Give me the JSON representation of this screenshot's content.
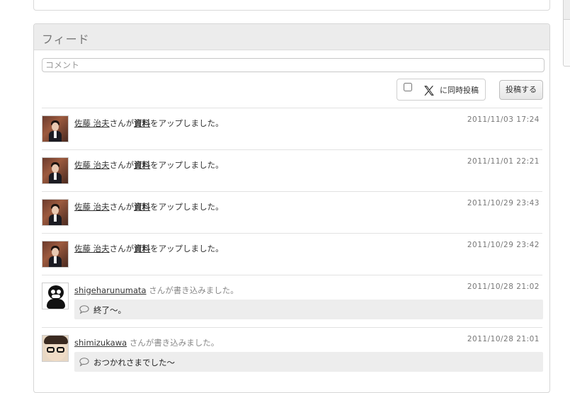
{
  "feed": {
    "title": "フィード",
    "comment_placeholder": "コメント",
    "x_share_label": "に同時投稿",
    "x_share_checked": false,
    "post_button": "投稿する"
  },
  "items": [
    {
      "user": "佐藤 治夫",
      "text_before": "さんが",
      "link": "資料",
      "text_after": "をアップしました。",
      "timestamp": "2011/11/03 17:24"
    },
    {
      "user": "佐藤 治夫",
      "text_before": "さんが",
      "link": "資料",
      "text_after": "をアップしました。",
      "timestamp": "2011/11/01 22:21"
    },
    {
      "user": "佐藤 治夫",
      "text_before": "さんが",
      "link": "資料",
      "text_after": "をアップしました。",
      "timestamp": "2011/10/29 23:43"
    },
    {
      "user": "佐藤 治夫",
      "text_before": "さんが",
      "link": "資料",
      "text_after": "をアップしました。",
      "timestamp": "2011/10/29 23:42"
    },
    {
      "user": "shigeharunumata",
      "text_after": "さんが書き込みました。",
      "timestamp": "2011/10/28 21:02",
      "comment": "終了〜。"
    },
    {
      "user": "shimizukawa",
      "text_after": "さんが書き込みました。",
      "timestamp": "2011/10/28 21:01",
      "comment": "おつかれさまでした〜"
    }
  ]
}
